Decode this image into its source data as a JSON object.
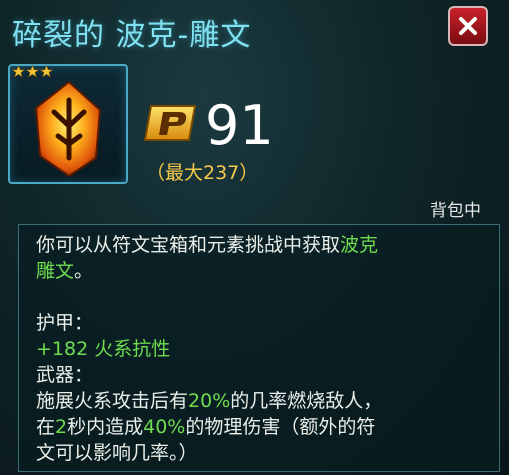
{
  "item": {
    "title": "碎裂的 波克-雕文",
    "stars": 3,
    "icon": "fire-rune-glyph-icon"
  },
  "price": {
    "currency_icon": "p-currency-icon",
    "value": "91",
    "max_label": "（最大237）"
  },
  "status": "背包中",
  "description": {
    "intro_prefix": "你可以从符文宝箱和元素挑战中获取",
    "intro_highlight_1": "波克",
    "intro_highlight_2": "雕文",
    "intro_suffix": "。",
    "armor_label": "护甲：",
    "armor_stat": "+182 火系抗性",
    "weapon_label": "武器：",
    "weapon_line1_prefix": "施展火系攻击后有",
    "weapon_line1_highlight": "20%",
    "weapon_line1_suffix": "的几率燃烧敌人，",
    "weapon_line2_prefix": "在",
    "weapon_line2_h1": "2",
    "weapon_line2_mid": "秒内造成",
    "weapon_line2_h2": "40%",
    "weapon_line2_suffix": "的物理伤害（额外的符",
    "weapon_line3": "文可以影响几率。）"
  },
  "colors": {
    "title": "#7fe0f0",
    "highlight_green": "#6fdc4f",
    "max_gold": "#f7c94a",
    "close_red": "#c9232b"
  }
}
